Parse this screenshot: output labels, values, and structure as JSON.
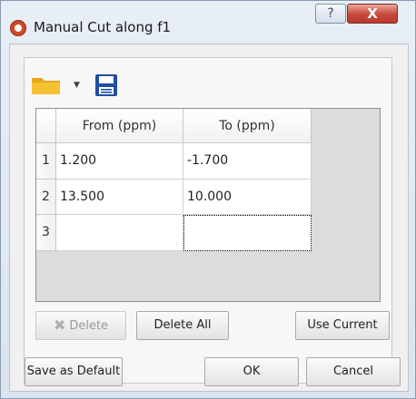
{
  "window": {
    "title": "Manual Cut along f1",
    "help_glyph": "?",
    "close_glyph": "X"
  },
  "toolbar": {
    "open_icon": "folder-icon",
    "dropdown_icon": "chevron-down-icon",
    "save_icon": "floppy-disk-icon"
  },
  "table": {
    "columns": [
      "From (ppm)",
      "To (ppm)"
    ],
    "rows": [
      {
        "num": "1",
        "from": "1.200",
        "to": "-1.700"
      },
      {
        "num": "2",
        "from": "13.500",
        "to": "10.000"
      },
      {
        "num": "3",
        "from": "",
        "to": ""
      }
    ]
  },
  "actions": {
    "delete": "Delete",
    "delete_all": "Delete All",
    "use_current": "Use Current"
  },
  "footer": {
    "save_default": "Save as Default",
    "ok": "OK",
    "cancel": "Cancel"
  },
  "colors": {
    "close_button": "#c6483a",
    "app_icon": "#c94b2c",
    "folder": "#f1b72a",
    "save": "#1f4fa0"
  }
}
